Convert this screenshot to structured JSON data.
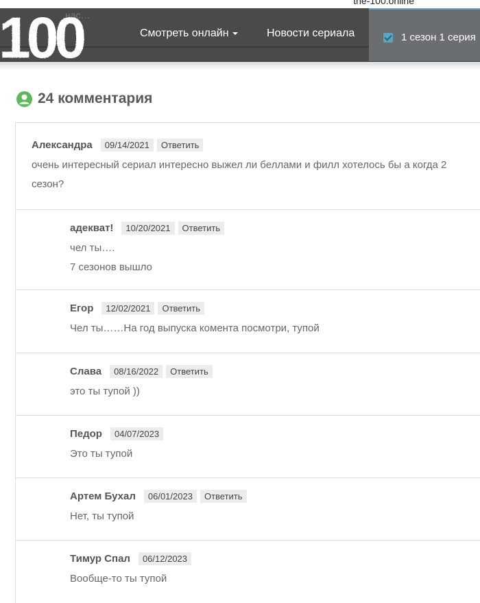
{
  "browser": {
    "url_fragment": "the-100.online"
  },
  "header": {
    "ghost_text": "нас…",
    "logo_text": "100",
    "nav": [
      {
        "label": "Смотреть онлайн",
        "has_dropdown": true
      },
      {
        "label": "Новости сериала",
        "has_dropdown": false
      }
    ],
    "season_label": "1 сезон 1 серия",
    "accent_color": "#5aa6c2",
    "bar_color": "#4a4a4a"
  },
  "comments_section": {
    "title": "24 комментария",
    "icon": "user-circle-icon",
    "icon_color": "#5cb85c",
    "comments": [
      {
        "author": "Александра",
        "date": "09/14/2021",
        "reply_label": "Ответить",
        "lines": [
          "очень интересный сериал интересно выжел ли беллами и филл хотелось бы а когда 2",
          "сезон?"
        ]
      },
      {
        "author": "адекват!",
        "date": "10/20/2021",
        "reply_label": "Ответить",
        "lines": [
          "чел ты….",
          "7 сезонов вышло"
        ]
      },
      {
        "author": "Егор",
        "date": "12/02/2021",
        "reply_label": "Ответить",
        "lines": [
          "Чел ты……На год выпуска комента посмотри, тупой"
        ]
      },
      {
        "author": "Слава",
        "date": "08/16/2022",
        "reply_label": "Ответить",
        "lines": [
          "это ты тупой ))"
        ]
      },
      {
        "author": "Педор",
        "date": "04/07/2023",
        "reply_label": "",
        "lines": [
          "Это ты тупой"
        ]
      },
      {
        "author": "Артем Бухал",
        "date": "06/01/2023",
        "reply_label": "Ответить",
        "lines": [
          "Нет, ты тупой"
        ]
      },
      {
        "author": "Тимур Спал",
        "date": "06/12/2023",
        "reply_label": "",
        "lines": [
          "Вообще-то ты тупой"
        ]
      }
    ]
  }
}
